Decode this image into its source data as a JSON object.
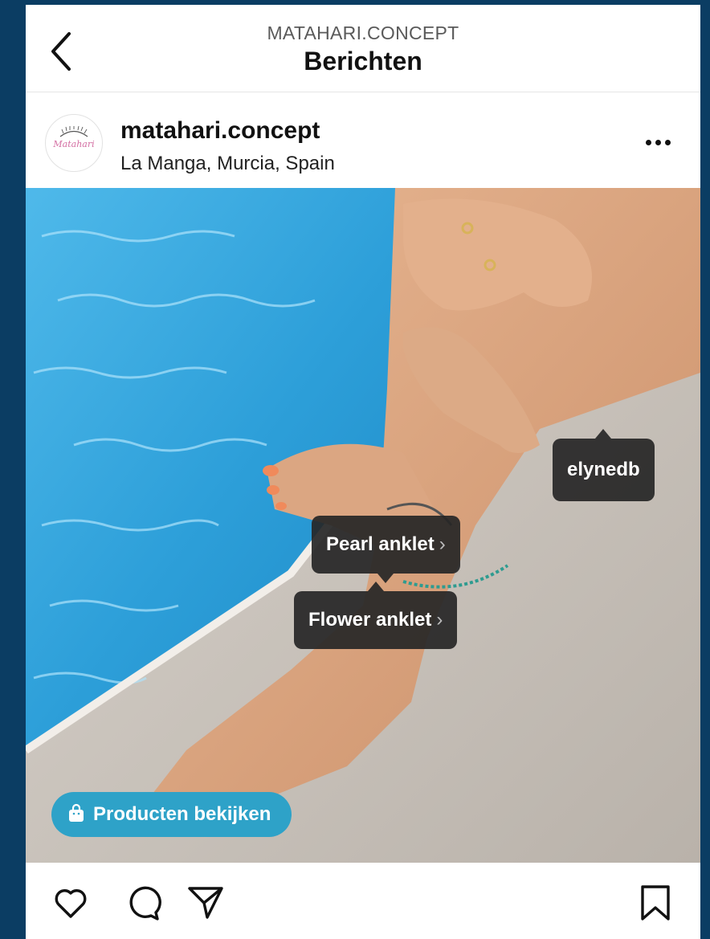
{
  "header": {
    "account_caption": "MATAHARI.CONCEPT",
    "title": "Berichten",
    "back_icon": "chevron-left-icon"
  },
  "post": {
    "avatar_text": "Matahari",
    "username": "matahari.concept",
    "location": "La Manga, Murcia, Spain",
    "more_icon": "more-horizontal-icon"
  },
  "photo": {
    "tags": {
      "user": "elynedb",
      "product_1": "Pearl anklet",
      "product_2": "Flower anklet",
      "chevron": "›"
    },
    "shop_button": "Producten bekijken",
    "shop_icon": "shopping-bag-icon"
  },
  "actions": {
    "like_icon": "heart-icon",
    "comment_icon": "comment-icon",
    "share_icon": "send-icon",
    "save_icon": "bookmark-icon"
  },
  "colors": {
    "background": "#0b3d63",
    "shop_pill": "#2ea2c8",
    "tag_bg": "#262626"
  }
}
